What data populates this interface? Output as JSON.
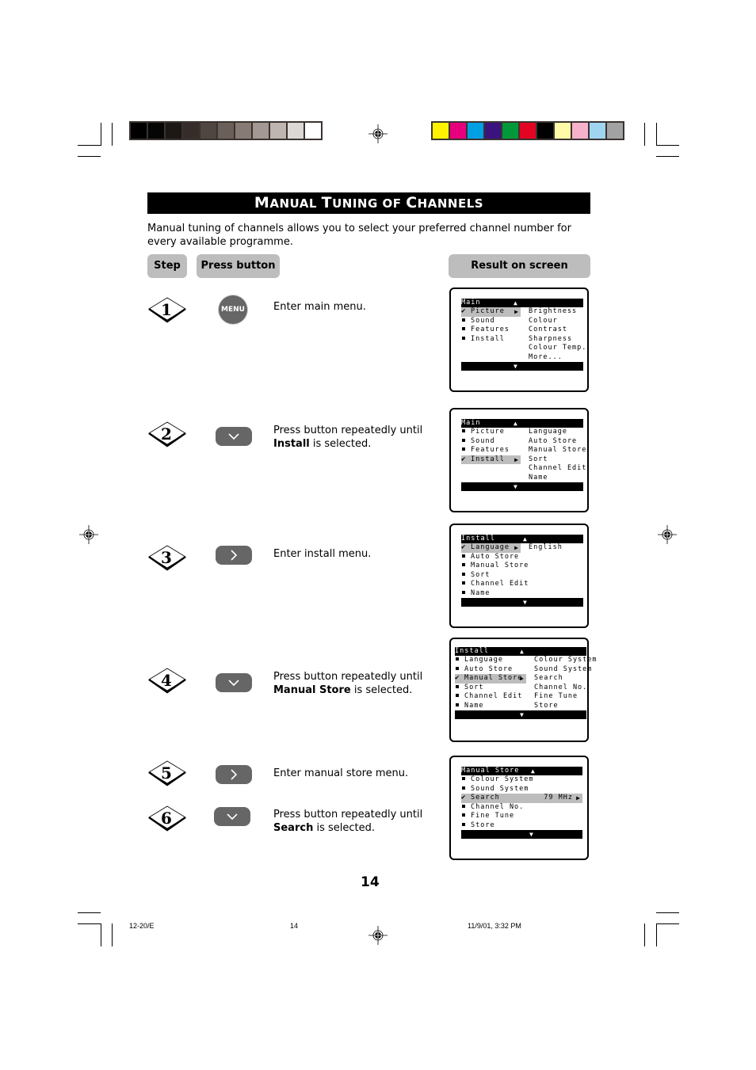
{
  "page": {
    "title_parts": [
      {
        "cap": "M",
        "rest": "ANUAL "
      },
      {
        "cap": "T",
        "rest": "UNING OF "
      },
      {
        "cap": "C",
        "rest": "HANNELS"
      }
    ],
    "intro": "Manual tuning of channels allows you to select your preferred channel number for every available programme.",
    "page_number": "14"
  },
  "headers": {
    "step": "Step",
    "press_button": "Press button",
    "result": "Result on screen"
  },
  "colour_bars": {
    "grey": [
      "#000000",
      "#050505",
      "#1c1816",
      "#362d2a",
      "#4f4541",
      "#6b5f5a",
      "#877b76",
      "#a39894",
      "#bfb5b1",
      "#dcd8d5",
      "#ffffff"
    ],
    "colour": [
      "#fff200",
      "#e6007e",
      "#00a0e3",
      "#3b137f",
      "#00983a",
      "#e30421",
      "#000000",
      "#fffaa8",
      "#f7b2cb",
      "#a0d5f2",
      "#a2a2a2"
    ]
  },
  "steps": [
    {
      "num": "1",
      "button": "MENU",
      "button_icon": "menu-button",
      "text_pre": "Enter main menu.",
      "text_bold": "",
      "text_post": ""
    },
    {
      "num": "2",
      "button": "",
      "button_icon": "chevron-down-icon",
      "text_pre": "Press button repeatedly until ",
      "text_bold": "Install",
      "text_post": " is selected."
    },
    {
      "num": "3",
      "button": "",
      "button_icon": "chevron-right-icon",
      "text_pre": "Enter install menu.",
      "text_bold": "",
      "text_post": ""
    },
    {
      "num": "4",
      "button": "",
      "button_icon": "chevron-down-icon",
      "text_pre": "Press button repeatedly until ",
      "text_bold": "Manual Store",
      "text_post": " is selected."
    },
    {
      "num": "5",
      "button": "",
      "button_icon": "chevron-right-icon",
      "text_pre": "Enter manual store menu.",
      "text_bold": "",
      "text_post": ""
    },
    {
      "num": "6",
      "button": "",
      "button_icon": "chevron-down-icon",
      "text_pre": "Press button repeatedly until ",
      "text_bold": "Search",
      "text_post": " is selected."
    }
  ],
  "screens": [
    {
      "header": "Main",
      "left": [
        "Picture",
        "Sound",
        "Features",
        "Install"
      ],
      "selected": 0,
      "right": [
        "Brightness",
        "Colour",
        "Contrast",
        "Sharpness",
        "Colour Temp.",
        "More..."
      ]
    },
    {
      "header": "Main",
      "left": [
        "Picture",
        "Sound",
        "Features",
        "Install"
      ],
      "selected": 3,
      "right": [
        "Language",
        "Auto Store",
        "Manual Store",
        "Sort",
        "Channel Edit",
        "Name"
      ]
    },
    {
      "header": "Install",
      "left": [
        "Language",
        "Auto Store",
        "Manual Store",
        "Sort",
        "Channel Edit",
        "Name"
      ],
      "selected": 0,
      "right": [
        "English"
      ]
    },
    {
      "header": "Install",
      "left": [
        "Language",
        "Auto Store",
        "Manual Store",
        "Sort",
        "Channel Edit",
        "Name"
      ],
      "selected": 2,
      "right": [
        "Colour System",
        "Sound System",
        "Search",
        "Channel No.",
        "Fine Tune",
        "Store"
      ]
    },
    {
      "header": "Manual Store",
      "left": [
        "Colour System",
        "Sound System",
        "Search",
        "Channel No.",
        "Fine Tune",
        "Store"
      ],
      "selected": 2,
      "value": "79 MHz"
    }
  ],
  "footer": {
    "doc_code": "12-20/E",
    "page": "14",
    "timestamp": "11/9/01, 3:32 PM"
  }
}
